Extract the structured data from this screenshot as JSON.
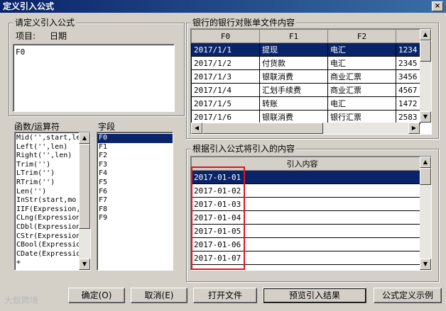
{
  "window": {
    "title": "定义引入公式",
    "close_glyph": "×"
  },
  "formula_group": {
    "legend": "请定义引入公式",
    "item_label": "项目:",
    "item_value": "日期",
    "formula_text": "F0"
  },
  "functions": {
    "label": "函数/运算符",
    "items": [
      "Mid('',start,le",
      "Left('',len)",
      "Right('',len)",
      "Trim('')",
      "LTrim('')",
      "RTrim('')",
      "Len('')",
      "InStr(start,mo",
      "IIF(Expression,",
      "CLng(Expression",
      "CDbl(Expression",
      "CStr(Expression",
      "CBool(Expressio",
      "CDate(Expressio",
      "+",
      "-"
    ]
  },
  "fields": {
    "label": "字段",
    "items": [
      "F0",
      "F1",
      "F2",
      "F3",
      "F4",
      "F5",
      "F6",
      "F7",
      "F8",
      "F9"
    ],
    "selected": "F0"
  },
  "bank_group": {
    "legend": "银行的银行对账单文件内容",
    "columns": [
      "F0",
      "F1",
      "F2",
      ""
    ],
    "rows": [
      [
        "2017/1/1",
        "提现",
        "电汇",
        "1234"
      ],
      [
        "2017/1/2",
        "付货款",
        "电汇",
        "2345"
      ],
      [
        "2017/1/3",
        "银联消费",
        "商业汇票",
        "3456"
      ],
      [
        "2017/1/4",
        "汇划手续费",
        "商业汇票",
        "4567"
      ],
      [
        "2017/1/5",
        "转账",
        "电汇",
        "1472"
      ],
      [
        "2017/1/6",
        "银联消费",
        "银行汇票",
        "2583"
      ]
    ]
  },
  "import_group": {
    "legend": "根据引入公式将引入的内容",
    "column": "引入内容",
    "rows": [
      "2017-01-01",
      "2017-01-02",
      "2017-01-03",
      "2017-01-04",
      "2017-01-05",
      "2017-01-06",
      "2017-01-07"
    ]
  },
  "buttons": {
    "ok": "确定(O)",
    "cancel": "取消(E)",
    "open_file": "打开文件",
    "preview": "预览引入结果",
    "examples": "公式定义示例"
  },
  "scroll": {
    "up": "▲",
    "down": "▼",
    "left": "◀",
    "right": "▶"
  },
  "watermark": "大蚁跨境",
  "colors": {
    "selection": "#0a246a",
    "highlight_box": "#e0141c",
    "title_bar": "#0a246a"
  }
}
